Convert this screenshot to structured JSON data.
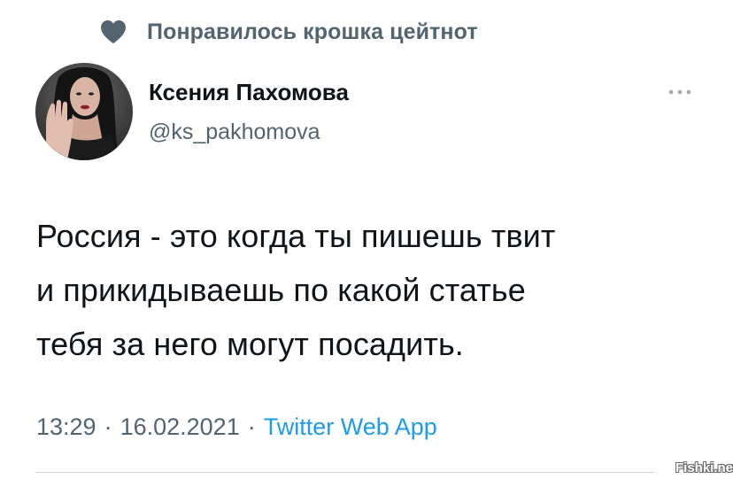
{
  "social_context": {
    "icon": "heart-icon",
    "text": "Понравилось крошка цейтнот"
  },
  "author": {
    "name": "Ксения Пахомова",
    "handle": "@ks_pakhomova"
  },
  "more_menu": {
    "icon": "more-dots-icon"
  },
  "tweet": {
    "lines": [
      "Россия - это когда ты пишешь твит",
      "и прикидываешь по какой статье",
      "тебя за него могут посадить."
    ]
  },
  "meta": {
    "time": "13:29",
    "separator_1": "·",
    "date": "16.02.2021",
    "separator_2": "·",
    "source": "Twitter Web App"
  },
  "watermark": "Fishki.net",
  "colors": {
    "text_primary": "#0f1419",
    "text_secondary": "#536471",
    "accent_link": "#1d9bf0",
    "divider": "#cfd9de"
  }
}
